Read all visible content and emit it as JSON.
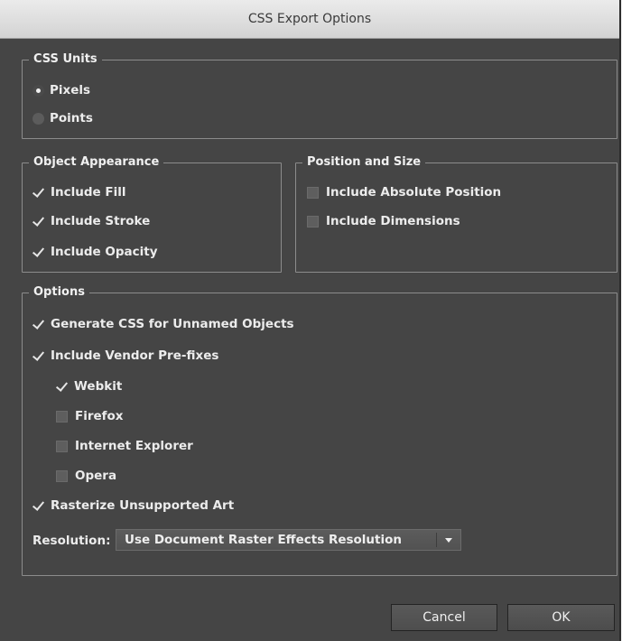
{
  "window": {
    "title": "CSS Export Options"
  },
  "css_units": {
    "legend": "CSS Units",
    "options": [
      {
        "label": "Pixels",
        "selected": true
      },
      {
        "label": "Points",
        "selected": false
      }
    ]
  },
  "object_appearance": {
    "legend": "Object Appearance",
    "items": [
      {
        "label": "Include Fill",
        "checked": true
      },
      {
        "label": "Include Stroke",
        "checked": true
      },
      {
        "label": "Include Opacity",
        "checked": true
      }
    ]
  },
  "position_size": {
    "legend": "Position and Size",
    "items": [
      {
        "label": "Include Absolute Position",
        "checked": false
      },
      {
        "label": "Include Dimensions",
        "checked": false
      }
    ]
  },
  "options": {
    "legend": "Options",
    "generate_unnamed": {
      "label": "Generate CSS for Unnamed Objects",
      "checked": true
    },
    "vendor_prefixes": {
      "label": "Include Vendor Pre-fixes",
      "checked": true
    },
    "vendors": [
      {
        "label": "Webkit",
        "checked": true
      },
      {
        "label": "Firefox",
        "checked": false
      },
      {
        "label": "Internet Explorer",
        "checked": false
      },
      {
        "label": "Opera",
        "checked": false
      }
    ],
    "rasterize": {
      "label": "Rasterize Unsupported Art",
      "checked": true
    },
    "resolution": {
      "label": "Resolution:",
      "value": "Use Document Raster Effects Resolution"
    }
  },
  "buttons": {
    "cancel": "Cancel",
    "ok": "OK"
  }
}
